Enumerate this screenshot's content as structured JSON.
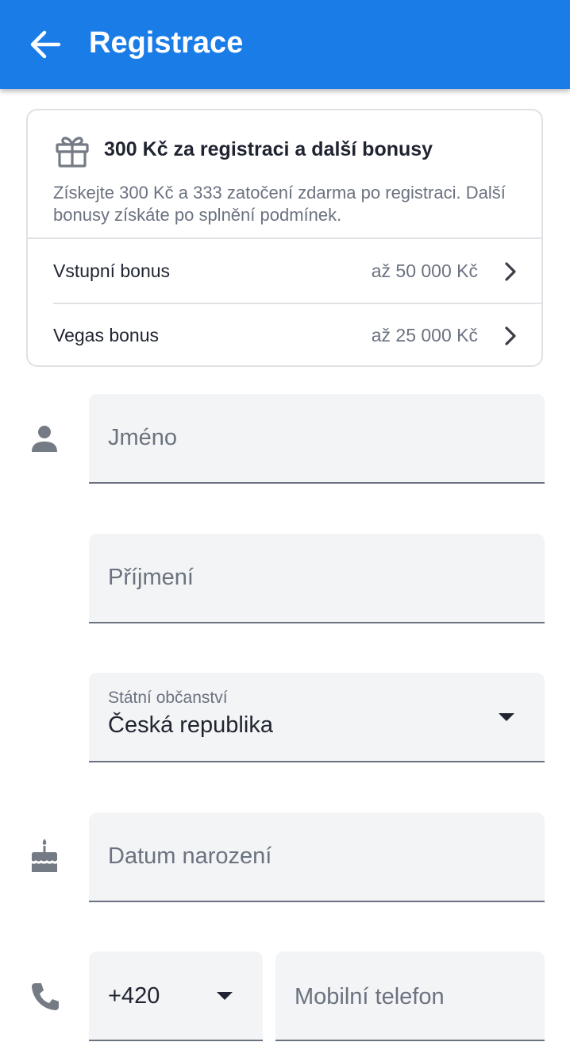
{
  "header": {
    "title": "Registrace",
    "back_icon": "arrow-left-icon"
  },
  "bonus_card": {
    "icon": "gift-icon",
    "title": "300 Kč za registraci a další bonusy",
    "description": "Získejte 300 Kč a 333 zatočení zdarma po registraci. Další bonusy získáte po splnění podmínek.",
    "items": [
      {
        "label": "Vstupní bonus",
        "value": "až 50 000 Kč"
      },
      {
        "label": "Vegas bonus",
        "value": "až 25 000 Kč"
      }
    ]
  },
  "form": {
    "first_name": {
      "placeholder": "Jméno",
      "value": ""
    },
    "last_name": {
      "placeholder": "Příjmení",
      "value": ""
    },
    "citizenship": {
      "label": "Státní občanství",
      "value": "Česká republika"
    },
    "birth_date": {
      "placeholder": "Datum narození",
      "value": ""
    },
    "phone_prefix": {
      "value": "+420"
    },
    "phone": {
      "placeholder": "Mobilní telefon",
      "value": ""
    }
  },
  "colors": {
    "accent": "#1a7ce6",
    "field_bg": "#f3f4f5",
    "muted_text": "#6b7280",
    "icon_gray": "#757b85"
  }
}
